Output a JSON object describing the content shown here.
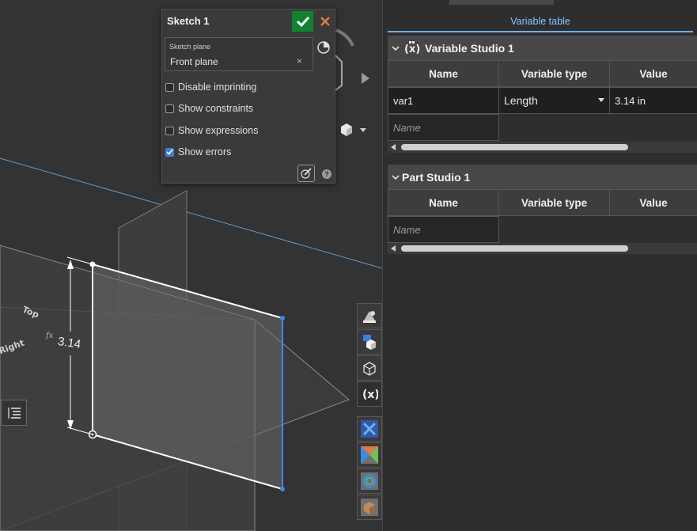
{
  "sketch_dialog": {
    "title": "Sketch 1",
    "sketch_plane_label": "Sketch plane",
    "sketch_plane_value": "Front plane",
    "clear_symbol": "×",
    "options": [
      {
        "label": "Disable imprinting",
        "checked": false
      },
      {
        "label": "Show constraints",
        "checked": false
      },
      {
        "label": "Show expressions",
        "checked": false
      },
      {
        "label": "Show errors",
        "checked": true
      }
    ],
    "help_symbol": "?"
  },
  "viewport": {
    "plane_labels": {
      "top": "Top",
      "right": "Right"
    },
    "dimension": {
      "prefix": "fx",
      "value": "3.14"
    }
  },
  "toolbar_icons": [
    "appearance-icon",
    "render-studio-icon",
    "exploded-view-icon",
    "variable-table-icon",
    "feature-x-icon",
    "section-view-icon",
    "ring-icon",
    "box-icon"
  ],
  "variable_panel": {
    "tab_label": "Variable table",
    "sections": [
      {
        "title": "Variable Studio 1",
        "columns": [
          "Name",
          "Variable type",
          "Value"
        ],
        "rows": [
          {
            "name": "var1",
            "type": "Length",
            "value": "3.14 in"
          }
        ],
        "name_placeholder": "Name"
      },
      {
        "title": "Part Studio 1",
        "columns": [
          "Name",
          "Variable type",
          "Value"
        ],
        "rows": [],
        "name_placeholder": "Name"
      }
    ]
  },
  "colors": {
    "accent": "#6fb1f0",
    "confirm": "#11822f",
    "cancel": "#e07a4a",
    "sketch_blue": "#3b8be8"
  }
}
